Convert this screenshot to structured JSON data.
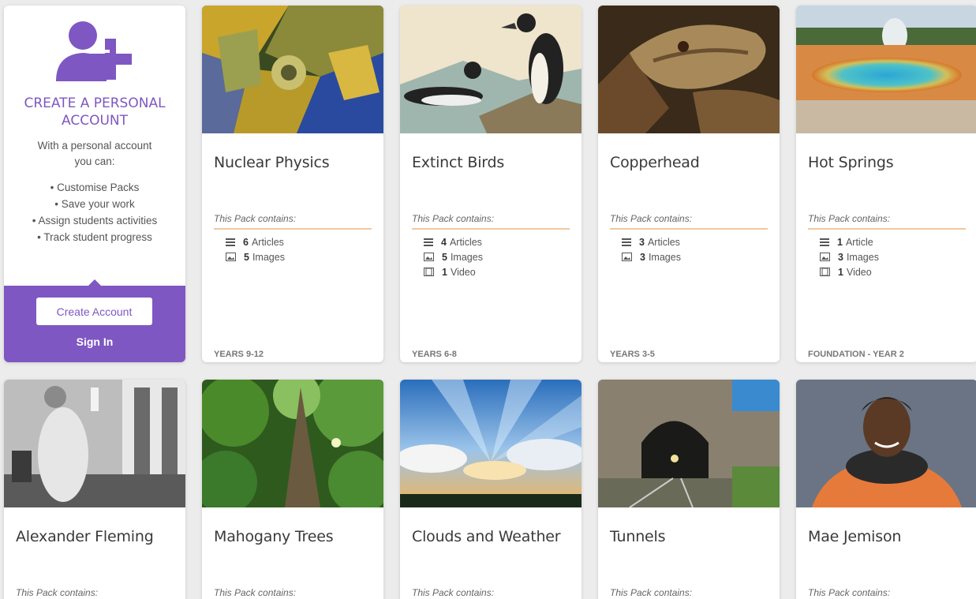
{
  "account": {
    "title_line1": "CREATE A PERSONAL",
    "title_line2": "ACCOUNT",
    "desc_line1": "With a personal account",
    "desc_line2": "you can:",
    "features": [
      "• Customise Packs",
      "• Save your work",
      "• Assign students activities",
      "• Track student progress"
    ],
    "create_button": "Create Account",
    "sign_in": "Sign In",
    "accent_color": "#7e57c2"
  },
  "contains_label": "This Pack contains:",
  "packs": [
    {
      "title": "Nuclear Physics",
      "years": "YEARS 9-12",
      "items": [
        {
          "icon": "articles-icon",
          "count": "6",
          "label": "Articles"
        },
        {
          "icon": "images-icon",
          "count": "5",
          "label": "Images"
        }
      ]
    },
    {
      "title": "Extinct Birds",
      "years": "YEARS 6-8",
      "items": [
        {
          "icon": "articles-icon",
          "count": "4",
          "label": "Articles"
        },
        {
          "icon": "images-icon",
          "count": "5",
          "label": "Images"
        },
        {
          "icon": "video-icon",
          "count": "1",
          "label": "Video"
        }
      ]
    },
    {
      "title": "Copperhead",
      "years": "YEARS 3-5",
      "items": [
        {
          "icon": "articles-icon",
          "count": "3",
          "label": "Articles"
        },
        {
          "icon": "images-icon",
          "count": "3",
          "label": "Images"
        }
      ]
    },
    {
      "title": "Hot Springs",
      "years": "FOUNDATION - YEAR 2",
      "items": [
        {
          "icon": "articles-icon",
          "count": "1",
          "label": "Article"
        },
        {
          "icon": "images-icon",
          "count": "3",
          "label": "Images"
        },
        {
          "icon": "video-icon",
          "count": "1",
          "label": "Video"
        }
      ]
    },
    {
      "title": "Alexander Fleming"
    },
    {
      "title": "Mahogany Trees"
    },
    {
      "title": "Clouds and Weather"
    },
    {
      "title": "Tunnels"
    },
    {
      "title": "Mae Jemison"
    }
  ]
}
